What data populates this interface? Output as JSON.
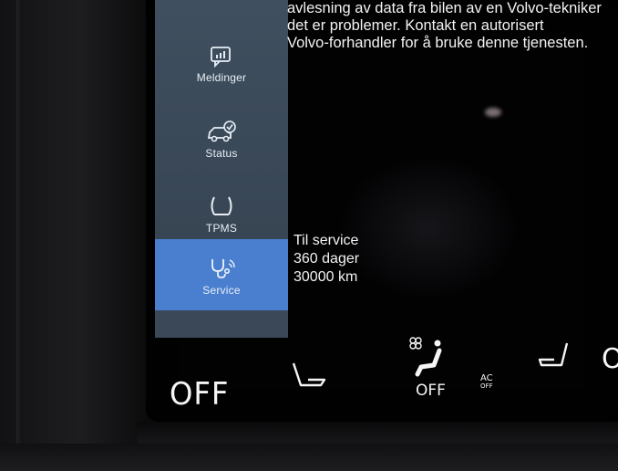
{
  "sidebar": {
    "items": [
      {
        "label": "Meldinger",
        "icon": "message-chart-icon"
      },
      {
        "label": "Status",
        "icon": "car-check-icon"
      },
      {
        "label": "TPMS",
        "icon": "tire-pressure-icon"
      },
      {
        "label": "Service",
        "icon": "stethoscope-icon",
        "active": true
      }
    ]
  },
  "message": {
    "lines": [
      "avlesning av data fra bilen av en Volvo-tekniker",
      "det er problemer. Kontakt en autorisert",
      "Volvo-forhandler for å bruke denne tjenesten."
    ]
  },
  "service": {
    "title": "Til service",
    "days": "360 dager",
    "distance": "30000 km"
  },
  "climate": {
    "left_off": "OFF",
    "fan_off": "OFF",
    "ac_label": "AC",
    "ac_off": "OFF",
    "right_partial": "O"
  },
  "colors": {
    "rail": "#3f4f5f",
    "active": "#4a7fd0",
    "text": "#f3f3f3"
  }
}
